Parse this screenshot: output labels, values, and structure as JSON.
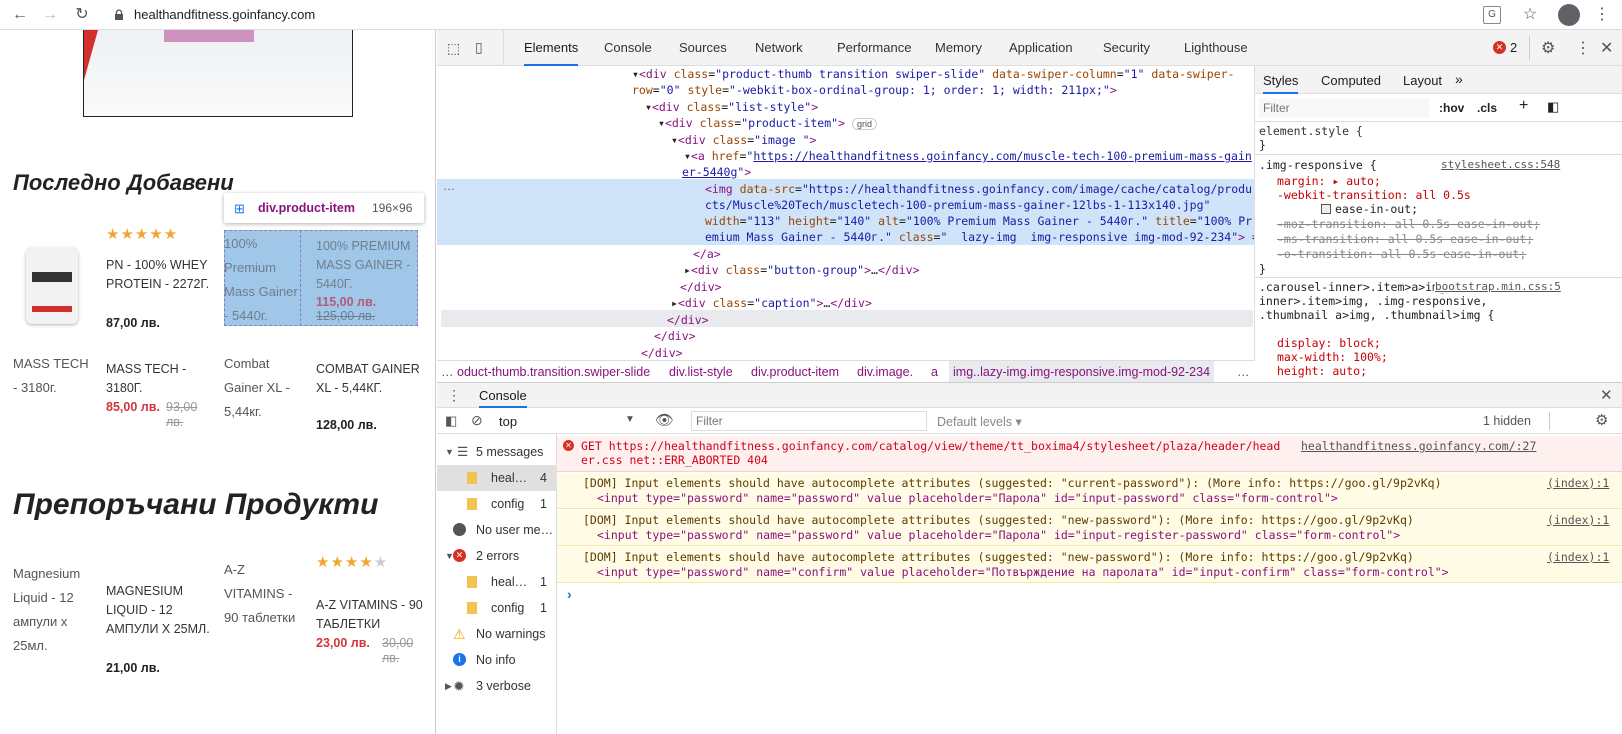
{
  "browser": {
    "url": "healthandfitness.goinfancy.com"
  },
  "page": {
    "section1_title": "Последно Добавени",
    "section2_title": "Препоръчани Продукти",
    "tooltip": {
      "name": "div.product-item",
      "size": "196×96"
    },
    "products1": [
      {
        "name": "PN - 100% WHEY PROTEIN - 2272Г.",
        "price": "87,00 лв."
      },
      {
        "alt": "100% Premium Mass Gainer - 5440г.",
        "name": "100% PREMIUM MASS GAINER - 5440Г.",
        "price": "115,00 лв.",
        "old_price": "125,00 лв."
      },
      {
        "alt": "MASS TECH - 3180г.",
        "name": "MASS TECH - 3180Г.",
        "price": "85,00 лв.",
        "old_price": "93,00 лв."
      },
      {
        "alt": "Combat Gainer XL - 5,44кг.",
        "name": "COMBAT GAINER XL - 5,44КГ.",
        "price": "128,00 лв."
      }
    ],
    "products2": [
      {
        "alt": "Magnesium Liquid - 12 ампули x 25мл.",
        "name": "MAGNESIUM LIQUID - 12 АМПУЛИ Х 25МЛ.",
        "price": "21,00 лв."
      },
      {
        "alt": "A-Z VITAMINS - 90 таблетки",
        "name": "A-Z VITAMINS - 90 ТАБЛЕТКИ",
        "price": "23,00 лв.",
        "old_price": "30,00 лв."
      }
    ]
  },
  "devtools": {
    "tabs": [
      "Elements",
      "Console",
      "Sources",
      "Network",
      "Performance",
      "Memory",
      "Application",
      "Security",
      "Lighthouse"
    ],
    "error_count": "2",
    "styles_tabs": [
      "Styles",
      "Computed",
      "Layout"
    ],
    "filter_placeholder": "Filter",
    "hov": ":hov",
    "cls": ".cls",
    "breadcrumbs": [
      "oduct-thumb.transition.swiper-slide",
      "div.list-style",
      "div.product-item",
      "div.image.",
      "a",
      "img..lazy-img.img-responsive.img-mod-92-234"
    ],
    "styles": {
      "element_style": "element.style {",
      "rule1_selector": ".img-responsive {",
      "rule1_source": "stylesheet.css:548",
      "rule1_props": [
        "margin: ▸ auto;",
        "-webkit-transition: all 0.5s",
        "ease-in-out;",
        "-moz-transition: all 0.5s ease-in-out;",
        "-ms-transition: all 0.5s ease-in-out;",
        "-o-transition: all 0.5s ease-in-out;"
      ],
      "rule2_selector": ".carousel-inner>.item>a>img, .carousel-inner>.item>img, .img-responsive, .thumbnail a>img, .thumbnail>img {",
      "rule2_source": "bootstrap.min.css:5",
      "rule2_props": [
        "display: block;",
        "max-width: 100%;",
        "height: auto;"
      ]
    },
    "drawer_tab": "Console",
    "console": {
      "context": "top",
      "filter_placeholder": "Filter",
      "levels": "Default levels ▾",
      "hidden": "1 hidden",
      "sidebar": [
        {
          "label": "5 messages",
          "count": ""
        },
        {
          "label": "heal…",
          "count": "4"
        },
        {
          "label": "config",
          "count": "1"
        },
        {
          "label": "No user me…",
          "count": ""
        },
        {
          "label": "2 errors",
          "count": ""
        },
        {
          "label": "heal…",
          "count": "1"
        },
        {
          "label": "config",
          "count": "1"
        },
        {
          "label": "No warnings",
          "count": ""
        },
        {
          "label": "No info",
          "count": ""
        },
        {
          "label": "3 verbose",
          "count": ""
        }
      ],
      "error": {
        "line1": "GET https://healthandfitness.goinfancy.com/catalog/view/theme/tt_boxima4/stylesheet/plaza/header/head",
        "line2": "er.css net::ERR_ABORTED 404",
        "source": "healthandfitness.goinfancy.com/:27"
      },
      "warnings": [
        {
          "text": "[DOM] Input elements should have autocomplete attributes (suggested: \"current-password\"): (More info: https://goo.gl/9p2vKq)",
          "code": "<input type=\"password\" name=\"password\" value placeholder=\"Парола\" id=\"input-password\" class=\"form-control\">",
          "source": "(index):1"
        },
        {
          "text": "[DOM] Input elements should have autocomplete attributes (suggested: \"new-password\"): (More info: https://goo.gl/9p2vKq)",
          "code": "<input type=\"password\" name=\"password\" value placeholder=\"Парола\" id=\"input-register-password\" class=\"form-control\">",
          "source": "(index):1"
        },
        {
          "text": "[DOM] Input elements should have autocomplete attributes (suggested: \"new-password\"): (More info: https://goo.gl/9p2vKq)",
          "code": "<input type=\"password\" name=\"confirm\" value placeholder=\"Потвърждение на паролата\" id=\"input-confirm\" class=\"form-control\">",
          "source": "(index):1"
        }
      ]
    }
  }
}
